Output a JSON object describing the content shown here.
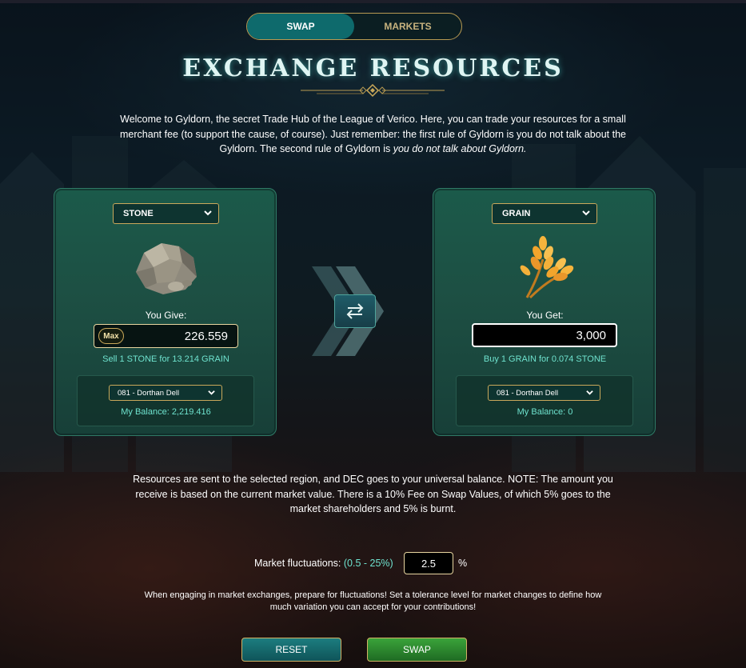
{
  "tabs": {
    "swap_label": "SWAP",
    "markets_label": "MARKETS",
    "active": "SWAP"
  },
  "page": {
    "title": "EXCHANGE RESOURCES",
    "intro_text": "Welcome to Gyldorn, the secret Trade Hub of the League of Verico. Here, you can trade your resources for a small merchant fee (to support the cause, of course). Just remember: the first rule of Gyldorn is you do not talk about the Gyldorn. The second rule of Gyldorn is ",
    "intro_italic": "you do not talk about Gyldorn."
  },
  "give_panel": {
    "resource_select": "STONE",
    "resource_icon": "stone-icon",
    "label": "You Give:",
    "max_label": "Max",
    "amount": "226.559",
    "rate_text": "Sell 1 STONE for 13.214 GRAIN",
    "region_select": "081 - Dorthan Dell",
    "balance_text": "My Balance: 2,219.416"
  },
  "get_panel": {
    "resource_select": "GRAIN",
    "resource_icon": "grain-icon",
    "label": "You Get:",
    "amount": "3,000",
    "rate_text": "Buy 1 GRAIN for 0.074 STONE",
    "region_select": "081 - Dorthan Dell",
    "balance_text": "My Balance: 0"
  },
  "note_text": "Resources are sent to the selected region, and DEC goes to your universal balance. NOTE: The amount you receive is based on the current market value. There is a 10% Fee on Swap Values, of which 5% goes to the market shareholders and 5% is burnt.",
  "fluctuation": {
    "label": "Market fluctuations: ",
    "range": "(0.5 - 25%)",
    "value": "2.5",
    "unit": "%"
  },
  "warning_text": "When engaging in market exchanges, prepare for fluctuations! Set a tolerance level for market changes to define how much variation you can accept for your contributions!",
  "buttons": {
    "reset_label": "RESET",
    "swap_label": "SWAP"
  },
  "colors": {
    "accent_teal": "#0e6a6c",
    "gold_border": "#c9a85a",
    "rate_text": "#6fe3cf",
    "swap_green": "#3aa33a"
  }
}
